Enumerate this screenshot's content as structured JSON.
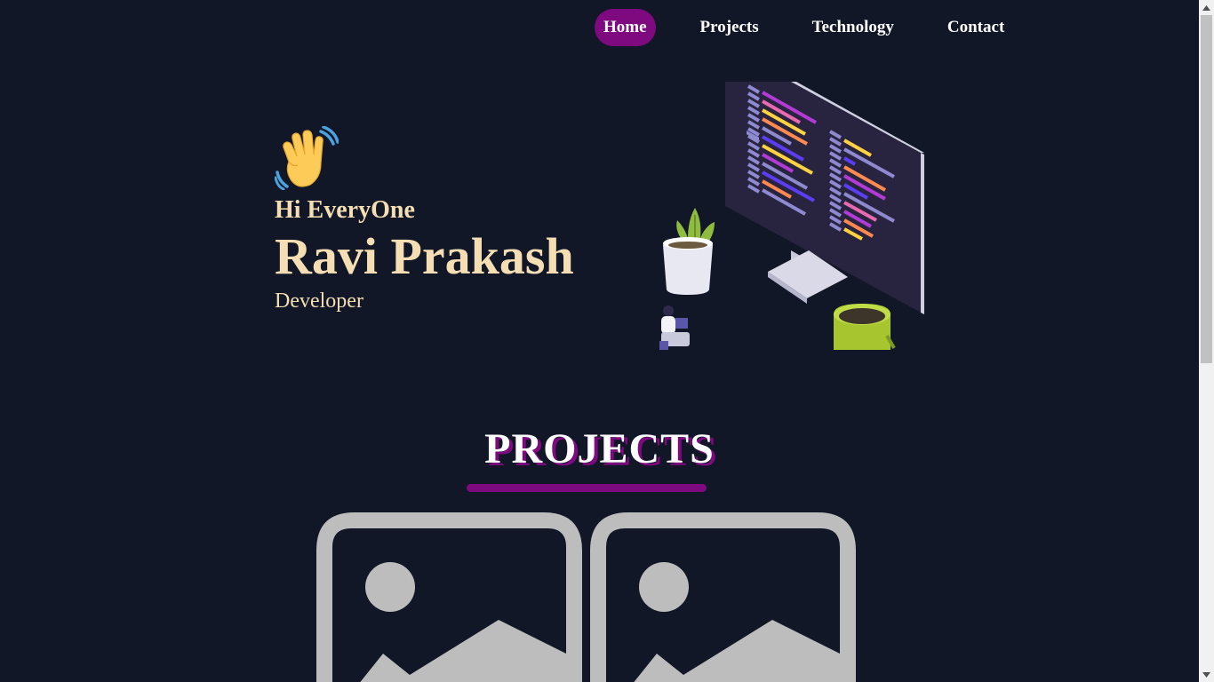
{
  "nav": {
    "items": [
      {
        "label": "Home",
        "active": true
      },
      {
        "label": "Projects",
        "active": false
      },
      {
        "label": "Technology",
        "active": false
      },
      {
        "label": "Contact",
        "active": false
      }
    ]
  },
  "hero": {
    "wave_icon": "waving-hand-icon",
    "greeting": "Hi EveryOne",
    "name": "Ravi Prakash",
    "role": "Developer",
    "illustration": "developer-workspace-illustration"
  },
  "projects": {
    "title": "PROJECTS",
    "cards": [
      {
        "icon": "image-placeholder-icon"
      },
      {
        "icon": "image-placeholder-icon"
      }
    ]
  },
  "colors": {
    "background": "#111727",
    "accent": "#7f0a7f",
    "hero_text": "#f5deb3",
    "nav_text": "#ffffff",
    "placeholder": "#bdbdbd"
  }
}
